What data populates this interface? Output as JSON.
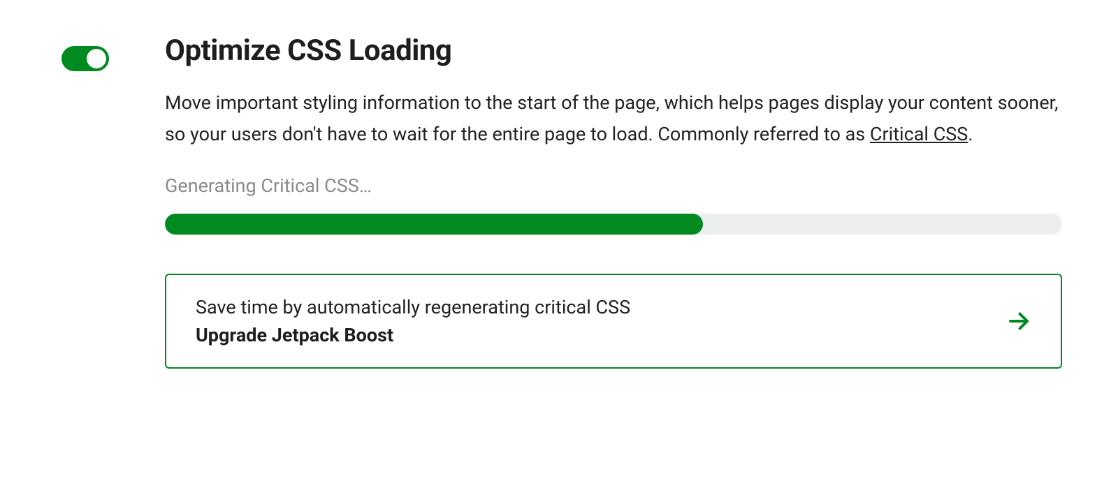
{
  "feature": {
    "toggle_enabled": true,
    "title": "Optimize CSS Loading",
    "description_prefix": "Move important styling information to the start of the page, which helps pages display your content sooner, so your users don't have to wait for the entire page to load. Commonly referred to as ",
    "description_link_text": "Critical CSS",
    "description_suffix": ".",
    "status_text": "Generating Critical CSS…",
    "progress_percent": 60,
    "upsell": {
      "line1": "Save time by automatically regenerating critical CSS",
      "line2": "Upgrade Jetpack Boost"
    }
  },
  "colors": {
    "accent": "#008a20"
  }
}
